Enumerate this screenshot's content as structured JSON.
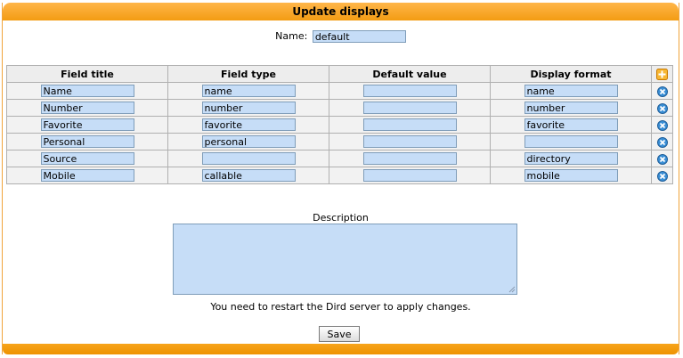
{
  "window": {
    "title": "Update displays"
  },
  "name_field": {
    "label": "Name:",
    "value": "default"
  },
  "table": {
    "headers": [
      "Field title",
      "Field type",
      "Default value",
      "Display format"
    ],
    "rows": [
      {
        "title": "Name",
        "type": "name",
        "default": "",
        "format": "name"
      },
      {
        "title": "Number",
        "type": "number",
        "default": "",
        "format": "number"
      },
      {
        "title": "Favorite",
        "type": "favorite",
        "default": "",
        "format": "favorite"
      },
      {
        "title": "Personal",
        "type": "personal",
        "default": "",
        "format": ""
      },
      {
        "title": "Source",
        "type": "",
        "default": "",
        "format": "directory"
      },
      {
        "title": "Mobile",
        "type": "callable",
        "default": "",
        "format": "mobile"
      }
    ]
  },
  "description": {
    "label": "Description",
    "value": ""
  },
  "notice": "You need to restart the Dird server to apply changes.",
  "save_label": "Save",
  "icons": {
    "add": "add-row-icon",
    "remove": "remove-row-icon"
  },
  "colors": {
    "accent": "#f39c12",
    "field_bg": "#c6ddf7",
    "remove_icon": "#3a8fd6",
    "add_icon": "#f0a11c"
  }
}
